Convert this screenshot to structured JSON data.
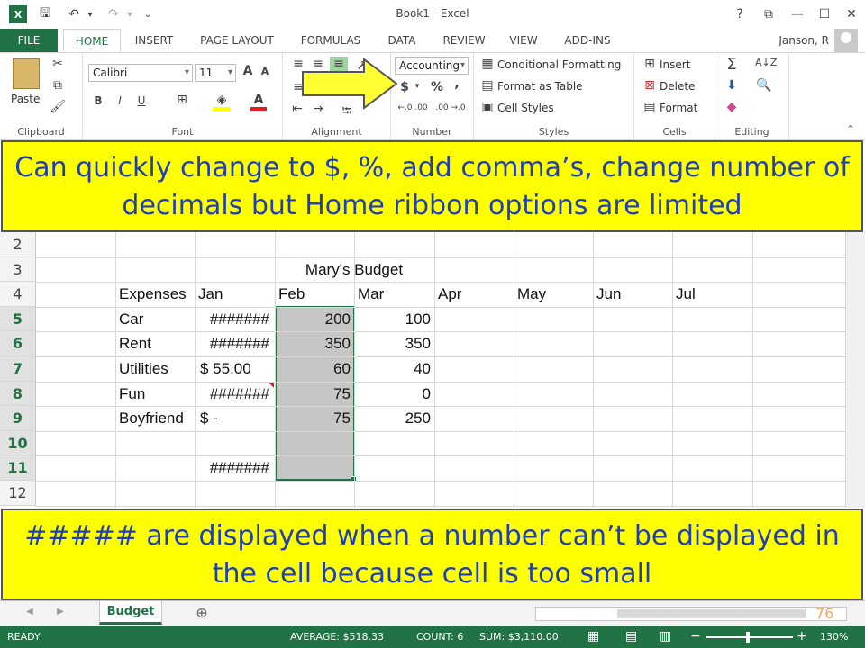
{
  "titlebar": {
    "title": "Book1 - Excel",
    "help": "?",
    "restore": "⧉",
    "minimize": "—",
    "maximize": "☐",
    "close": "✕"
  },
  "tabs": [
    "FILE",
    "HOME",
    "INSERT",
    "PAGE LAYOUT",
    "FORMULAS",
    "DATA",
    "REVIEW",
    "VIEW",
    "ADD-INS"
  ],
  "user": "Janson, R",
  "ribbon": {
    "clipboard": {
      "paste": "Paste",
      "label": "Clipboard"
    },
    "font": {
      "name": "Calibri",
      "size": "11",
      "bold": "B",
      "italic": "I",
      "underline": "U",
      "grow": "A",
      "shrink": "A",
      "color_a": "A",
      "label": "Font"
    },
    "alignment": {
      "label": "Alignment"
    },
    "number": {
      "format": "Accounting",
      "currency": "$",
      "percent": "%",
      "comma": ",",
      "inc_dec": "←.0 .00",
      "dec_dec": ".00 →.0",
      "label": "Number"
    },
    "styles": {
      "cond": "Conditional Formatting",
      "table": "Format as Table",
      "cell": "Cell Styles",
      "label": "Styles"
    },
    "cells": {
      "insert": "Insert",
      "delete": "Delete",
      "format": "Format",
      "label": "Cells"
    },
    "editing": {
      "label": "Editing"
    }
  },
  "callouts": {
    "top": "Can quickly change to $, %, add comma’s, change number of decimals but Home ribbon options are limited",
    "bottom": "##### are displayed when a number can’t be displayed in the cell because cell is too small"
  },
  "sheet": {
    "rows": [
      "2",
      "3",
      "4",
      "5",
      "6",
      "7",
      "8",
      "9",
      "10",
      "11",
      "12"
    ],
    "title": "Mary's Budget",
    "months": [
      "Jan",
      "Feb",
      "Mar",
      "Apr",
      "May",
      "Jun",
      "Jul"
    ],
    "expenses_header": "Expenses",
    "items": [
      {
        "name": "Car",
        "jan": "#######",
        "feb": "200",
        "mar": "100"
      },
      {
        "name": "Rent",
        "jan": "#######",
        "feb": "350",
        "mar": "350"
      },
      {
        "name": "Utilities",
        "jan": "$  55.00",
        "feb": "60",
        "mar": "40"
      },
      {
        "name": "Fun",
        "jan": "#######",
        "feb": "75",
        "mar": "0"
      },
      {
        "name": "Boyfriend",
        "jan": "$     -",
        "feb": "75",
        "mar": "250"
      }
    ],
    "row11_jan": "#######"
  },
  "sheet_tab": "Budget",
  "add_sheet": "⊕",
  "slide_number": "76",
  "status": {
    "ready": "READY",
    "average": "AVERAGE: $518.33",
    "count": "COUNT: 6",
    "sum": "SUM: $3,110.00",
    "zoom": "130%"
  }
}
